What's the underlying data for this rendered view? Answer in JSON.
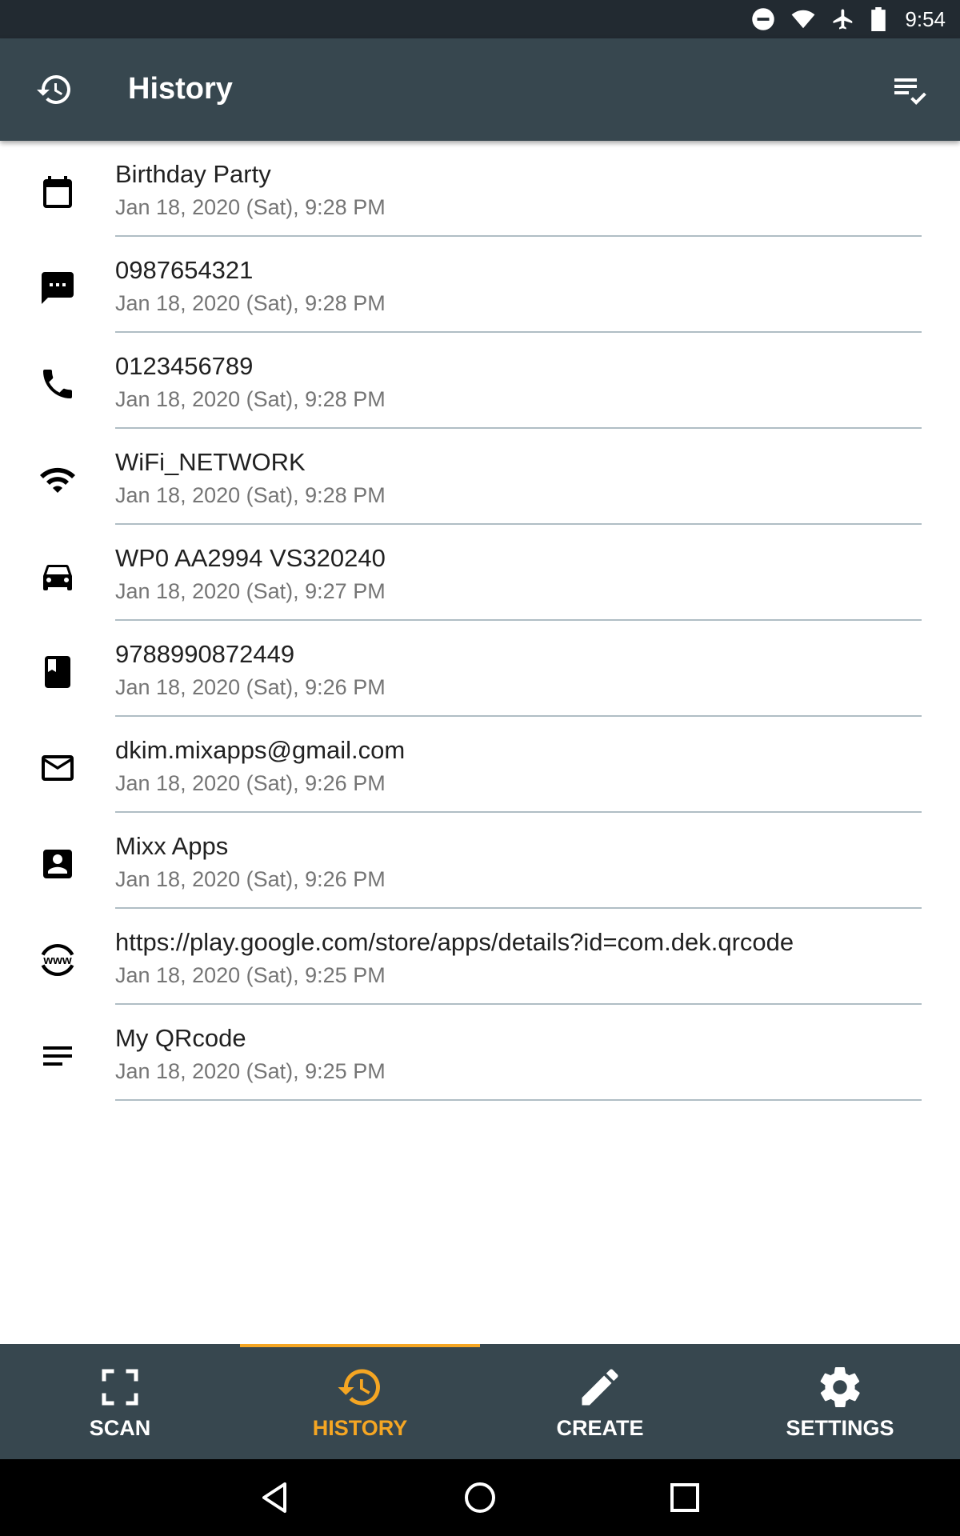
{
  "status_bar": {
    "time": "9:54",
    "icons": [
      "do-not-disturb-icon",
      "wifi-icon",
      "airplane-icon",
      "battery-icon"
    ]
  },
  "app_bar": {
    "title": "History",
    "nav_icon": "history-icon",
    "action_icon": "select-all-icon"
  },
  "history": {
    "items": [
      {
        "icon": "calendar-icon",
        "title": "Birthday Party",
        "date": "Jan 18, 2020 (Sat), 9:28 PM"
      },
      {
        "icon": "sms-icon",
        "title": "0987654321",
        "date": "Jan 18, 2020 (Sat), 9:28 PM"
      },
      {
        "icon": "phone-icon",
        "title": "0123456789",
        "date": "Jan 18, 2020 (Sat), 9:28 PM"
      },
      {
        "icon": "wifi-icon",
        "title": "WiFi_NETWORK",
        "date": "Jan 18, 2020 (Sat), 9:28 PM"
      },
      {
        "icon": "car-icon",
        "title": "WP0 AA2994 VS320240",
        "date": "Jan 18, 2020 (Sat), 9:27 PM"
      },
      {
        "icon": "book-icon",
        "title": "9788990872449",
        "date": "Jan 18, 2020 (Sat), 9:26 PM"
      },
      {
        "icon": "email-icon",
        "title": "dkim.mixapps@gmail.com",
        "date": "Jan 18, 2020 (Sat), 9:26 PM"
      },
      {
        "icon": "contact-icon",
        "title": "Mixx Apps",
        "date": "Jan 18, 2020 (Sat), 9:26 PM"
      },
      {
        "icon": "www-icon",
        "title": "https://play.google.com/store/apps/details?id=com.dek.qrcode",
        "date": "Jan 18, 2020 (Sat), 9:25 PM"
      },
      {
        "icon": "text-icon",
        "title": "My QRcode",
        "date": "Jan 18, 2020 (Sat), 9:25 PM"
      }
    ]
  },
  "bottom_nav": {
    "active_color": "#f5a623",
    "tabs": [
      {
        "label": "SCAN",
        "icon": "scan-icon"
      },
      {
        "label": "HISTORY",
        "icon": "history-icon"
      },
      {
        "label": "CREATE",
        "icon": "pencil-icon"
      },
      {
        "label": "SETTINGS",
        "icon": "gear-icon"
      }
    ]
  },
  "system_nav": {
    "buttons": [
      "back-icon",
      "home-icon",
      "recents-icon"
    ]
  }
}
